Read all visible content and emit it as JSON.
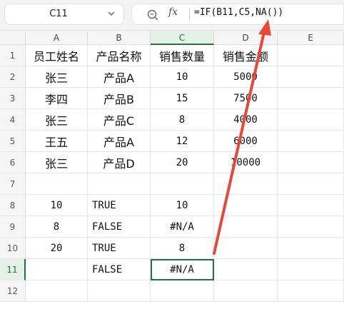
{
  "formula_bar": {
    "name_box": "C11",
    "fx_label": "fx",
    "formula": "=IF(B11,C5,NA())"
  },
  "columns": [
    "A",
    "B",
    "C",
    "D",
    "E"
  ],
  "rows": [
    "1",
    "2",
    "3",
    "4",
    "5",
    "6",
    "7",
    "8",
    "9",
    "10",
    "11",
    "12"
  ],
  "cells": {
    "A1": "员工姓名",
    "B1": "产品名称",
    "C1": "销售数量",
    "D1": "销售金额",
    "A2": "张三",
    "B2": "产品A",
    "C2": "10",
    "D2": "5000",
    "A3": "李四",
    "B3": "产品B",
    "C3": "15",
    "D3": "7500",
    "A4": "张三",
    "B4": "产品C",
    "C4": "8",
    "D4": "4000",
    "A5": "王五",
    "B5": "产品A",
    "C5": "12",
    "D5": "6000",
    "A6": "张三",
    "B6": "产品D",
    "C6": "20",
    "D6": "10000",
    "A8": "10",
    "B8": "TRUE",
    "C8": "10",
    "A9": "8",
    "B9": "FALSE",
    "C9": "#N/A",
    "A10": "20",
    "B10": "TRUE",
    "C10": "8",
    "B11": "FALSE",
    "C11": "#N/A"
  },
  "selected_cell": "C11",
  "colors": {
    "selection": "#217346",
    "arrow": "#e8483a"
  }
}
